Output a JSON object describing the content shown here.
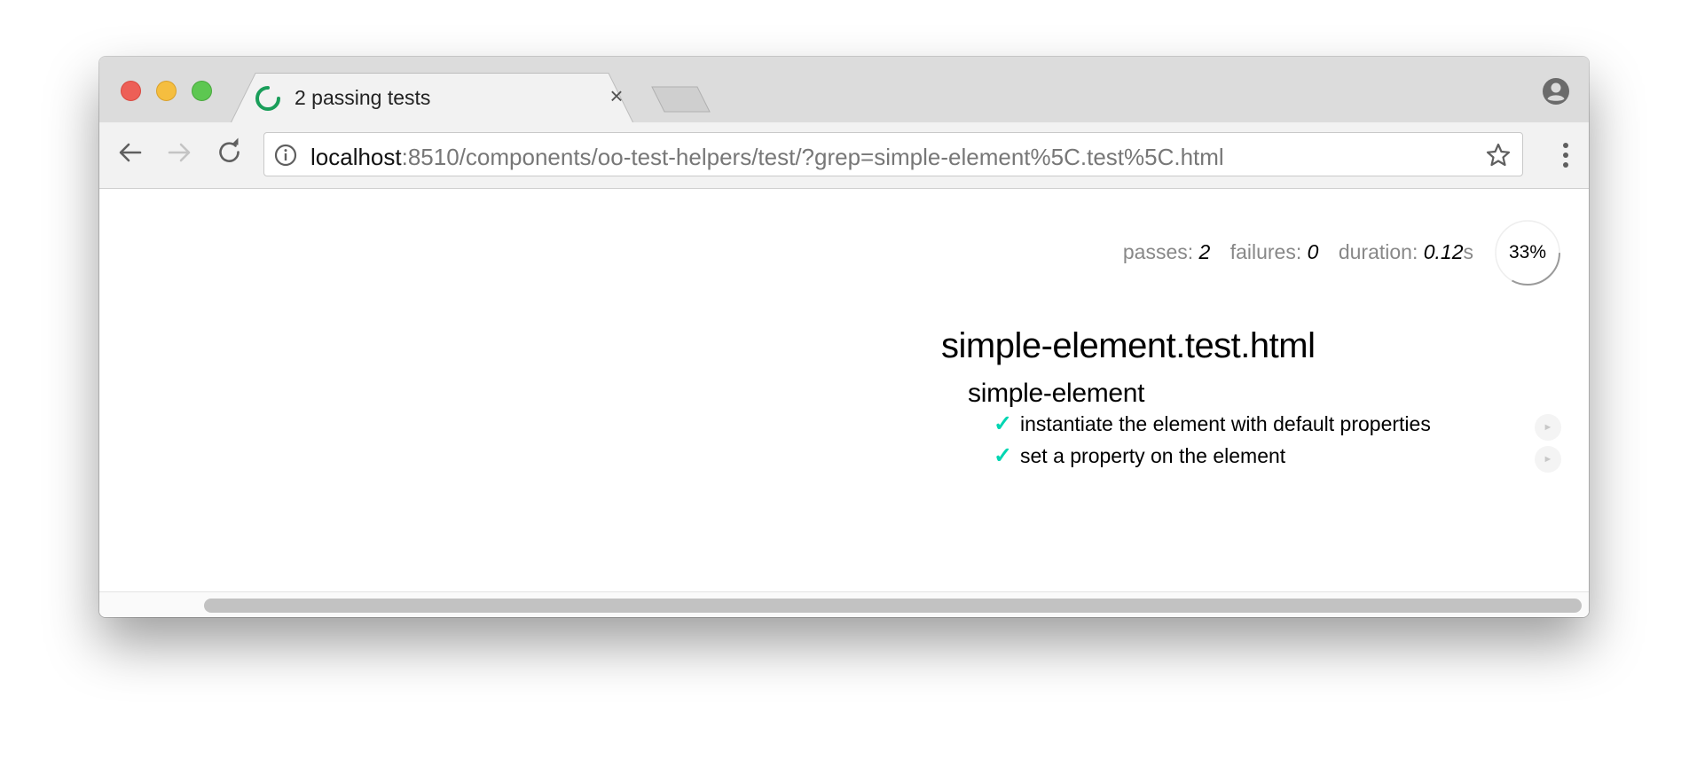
{
  "tab": {
    "title": "2 passing tests",
    "close_glyph": "×",
    "spinner_color": "#1a9e5a"
  },
  "toolbar": {
    "url_host": "localhost",
    "url_rest": ":8510/components/oo-test-helpers/test/?grep=simple-element%5C.test%5C.html"
  },
  "stats": {
    "passes_label": "passes:",
    "passes": "2",
    "failures_label": "failures:",
    "failures": "0",
    "duration_label": "duration:",
    "duration": "0.12",
    "duration_unit": "s",
    "progress_label": "33%",
    "progress_fraction": 0.33
  },
  "report": {
    "suite_title": "simple-element.test.html",
    "sub_suite_title": "simple-element",
    "tests": [
      {
        "check": "✓",
        "label": "instantiate the element with default properties",
        "replay": "►"
      },
      {
        "check": "✓",
        "label": "set a property on the element",
        "replay": "►"
      }
    ],
    "pass_color": "#00d6b2"
  },
  "icons": [
    "close-dot",
    "minimize-dot",
    "maximize-dot",
    "spinner-icon",
    "profile-icon",
    "back-icon",
    "forward-icon",
    "reload-icon",
    "info-icon",
    "star-icon",
    "menu-icon",
    "replay-icon"
  ]
}
